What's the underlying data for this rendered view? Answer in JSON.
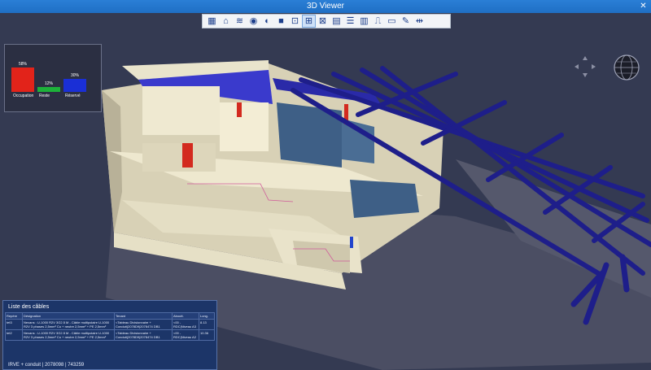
{
  "window": {
    "title": "3D Viewer",
    "close_symbol": "✕"
  },
  "toolbar": {
    "buttons": [
      {
        "name": "table-icon",
        "glyph": "▦"
      },
      {
        "name": "home-icon",
        "glyph": "⌂"
      },
      {
        "name": "layers-icon",
        "glyph": "≋"
      },
      {
        "name": "view-icon",
        "glyph": "◉"
      },
      {
        "name": "section-view-icon",
        "glyph": "◐"
      },
      {
        "name": "cube-icon",
        "glyph": "■"
      },
      {
        "name": "clipping-icon",
        "glyph": "⊡"
      },
      {
        "name": "fit-view-icon",
        "glyph": "⊞"
      },
      {
        "name": "select-icon",
        "glyph": "⊠"
      },
      {
        "name": "grid-icon",
        "glyph": "▤"
      },
      {
        "name": "properties-icon",
        "glyph": "☰"
      },
      {
        "name": "chart-icon",
        "glyph": "▥"
      },
      {
        "name": "measure-icon",
        "glyph": "⎍"
      },
      {
        "name": "print-icon",
        "glyph": "▭"
      },
      {
        "name": "annotate-icon",
        "glyph": "✎"
      },
      {
        "name": "move-icon",
        "glyph": "⇹"
      }
    ],
    "active_index": 7
  },
  "stats": {
    "items": [
      {
        "label": "Occupation",
        "pct": "58%",
        "value": 58,
        "color": "#e2231a"
      },
      {
        "label": "Reste",
        "pct": "12%",
        "value": 12,
        "color": "#1db23a"
      },
      {
        "label": "Réservé",
        "pct": "30%",
        "value": 30,
        "color": "#1a2fd6"
      }
    ]
  },
  "cables": {
    "title": "Liste des câbles",
    "headers": [
      "Repère",
      "Désignation",
      "Tenant",
      "Aboutt.",
      "Long."
    ],
    "rows": [
      {
        "repere": "tet3",
        "designation": "Nexans : U-1000 R2V 3G2.5 M - Câble multipolaire U-1000 R2V 3 phases 2,5mm² Cu + neutre 2,5mm² + PE 2,5mm²",
        "tenant": "<Tableau Divisionnaire + Conduit(2078D9|2078474 DB1",
        "about": "<00 - RDC|Niveau A3",
        "long": "8.13"
      },
      {
        "repere": "tet2",
        "designation": "Nexans : U-1000 R2V 3G2.5 M - Câble multipolaire U-1000 R2V 3 phases 2,5mm² Cu + neutre 2,5mm² + PE 2,5mm²",
        "tenant": "<Tableau Divisionnaire + Conduit(2078D9|2078474 DB1",
        "about": "<00 - RDC|Niveau A2",
        "long": "10.36"
      }
    ],
    "status": "IRVE + conduit | 2078098 | 743259"
  },
  "scene": {
    "colors": {
      "background": "#343a52",
      "ground": "#4d5066",
      "walls": "#e8e2c8",
      "beams": "#1f1f8e",
      "roof": "#3a3acc",
      "doors": "#d32a1f",
      "glass": "#3e5f86"
    }
  }
}
